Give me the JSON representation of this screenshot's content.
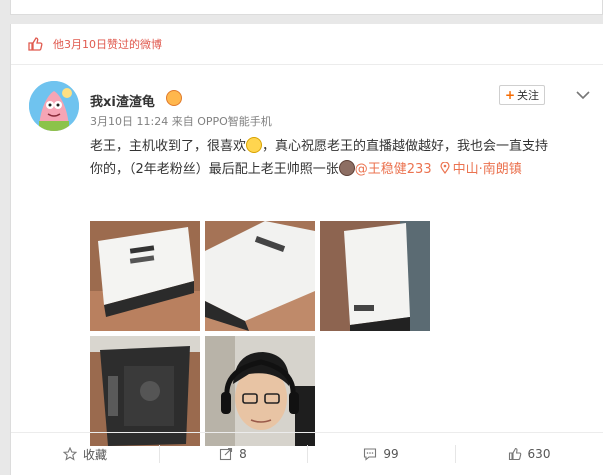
{
  "liked_bar": {
    "text": "他3月10日赞过的微博"
  },
  "post": {
    "username": "我xi渣渣龟",
    "time": "3月10日 11:24",
    "source_prefix": "来自",
    "source": "OPPO智能手机",
    "follow_label": "关注",
    "text_line1_a": "老王，主机收到了，很喜欢",
    "text_line1_b": "，真心祝愿老王的直播越做越好，我也会一直支持",
    "text_line2_a": "你的，（2年老粉丝）最后配上老王帅照一张",
    "mention": "@王稳健233",
    "location": "中山·南朗镇"
  },
  "actions": {
    "favorite": "收藏",
    "repost": "8",
    "comment": "99",
    "like": "630"
  },
  "colors": {
    "accent": "#eb7350",
    "liked_text": "#e05a4f",
    "follow_plus": "#f56a00"
  },
  "icons": [
    "thumbs-up-icon",
    "avatar-patrick",
    "vip-badge-icon",
    "chevron-down-icon",
    "location-pin-icon",
    "star-icon",
    "repost-icon",
    "comment-icon",
    "like-icon"
  ]
}
